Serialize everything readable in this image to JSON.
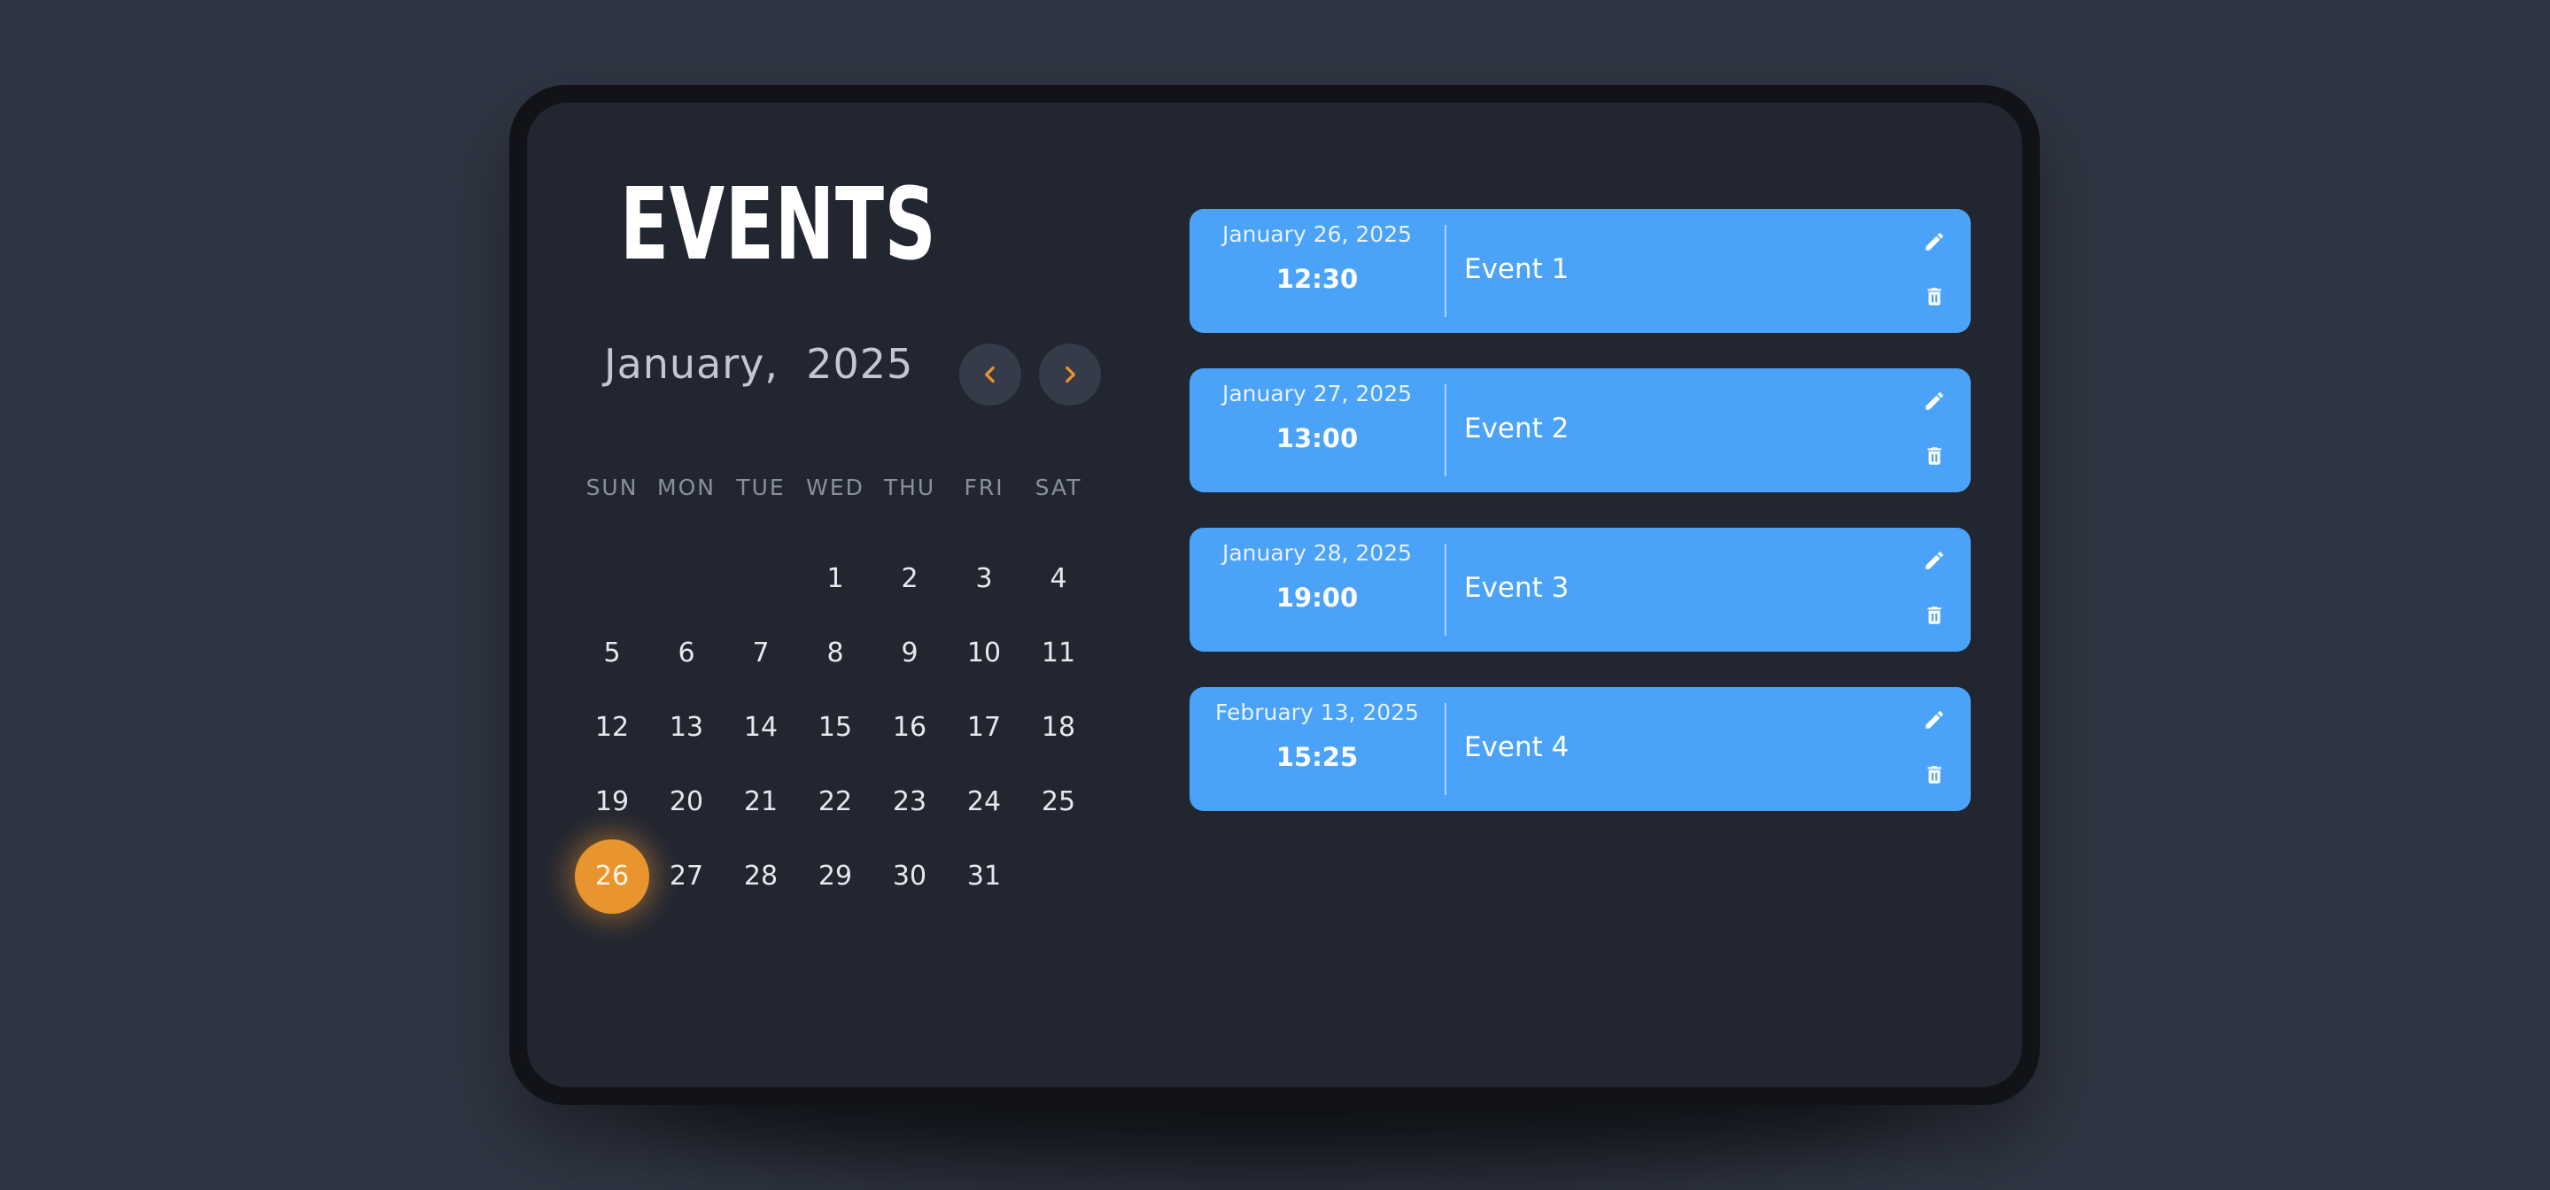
{
  "app": {
    "title": "EVENTS"
  },
  "calendar": {
    "month_label": "January,  2025",
    "prev_icon": "chevron-left-icon",
    "next_icon": "chevron-right-icon",
    "weekdays": [
      "SUN",
      "MON",
      "TUE",
      "WED",
      "THU",
      "FRI",
      "SAT"
    ],
    "days": [
      "1",
      "2",
      "3",
      "4",
      "5",
      "6",
      "7",
      "8",
      "9",
      "10",
      "11",
      "12",
      "13",
      "14",
      "15",
      "16",
      "17",
      "18",
      "19",
      "20",
      "21",
      "22",
      "23",
      "24",
      "25",
      "26",
      "27",
      "28",
      "29",
      "30",
      "31"
    ],
    "selected_day": "26",
    "accent_color": "#e8952f"
  },
  "events": [
    {
      "date": "January 26, 2025",
      "time": "12:30",
      "name": "Event 1",
      "edit_icon": "pencil-icon",
      "delete_icon": "trash-icon"
    },
    {
      "date": "January 27, 2025",
      "time": "13:00",
      "name": "Event 2",
      "edit_icon": "pencil-icon",
      "delete_icon": "trash-icon"
    },
    {
      "date": "January 28, 2025",
      "time": "19:00",
      "name": "Event 3",
      "edit_icon": "pencil-icon",
      "delete_icon": "trash-icon"
    },
    {
      "date": "February 13, 2025",
      "time": "15:25",
      "name": "Event 4",
      "edit_icon": "pencil-icon",
      "delete_icon": "trash-icon"
    }
  ],
  "colors": {
    "background": "#2f3542",
    "panel": "#222631",
    "event_card": "#4aa3f8"
  }
}
